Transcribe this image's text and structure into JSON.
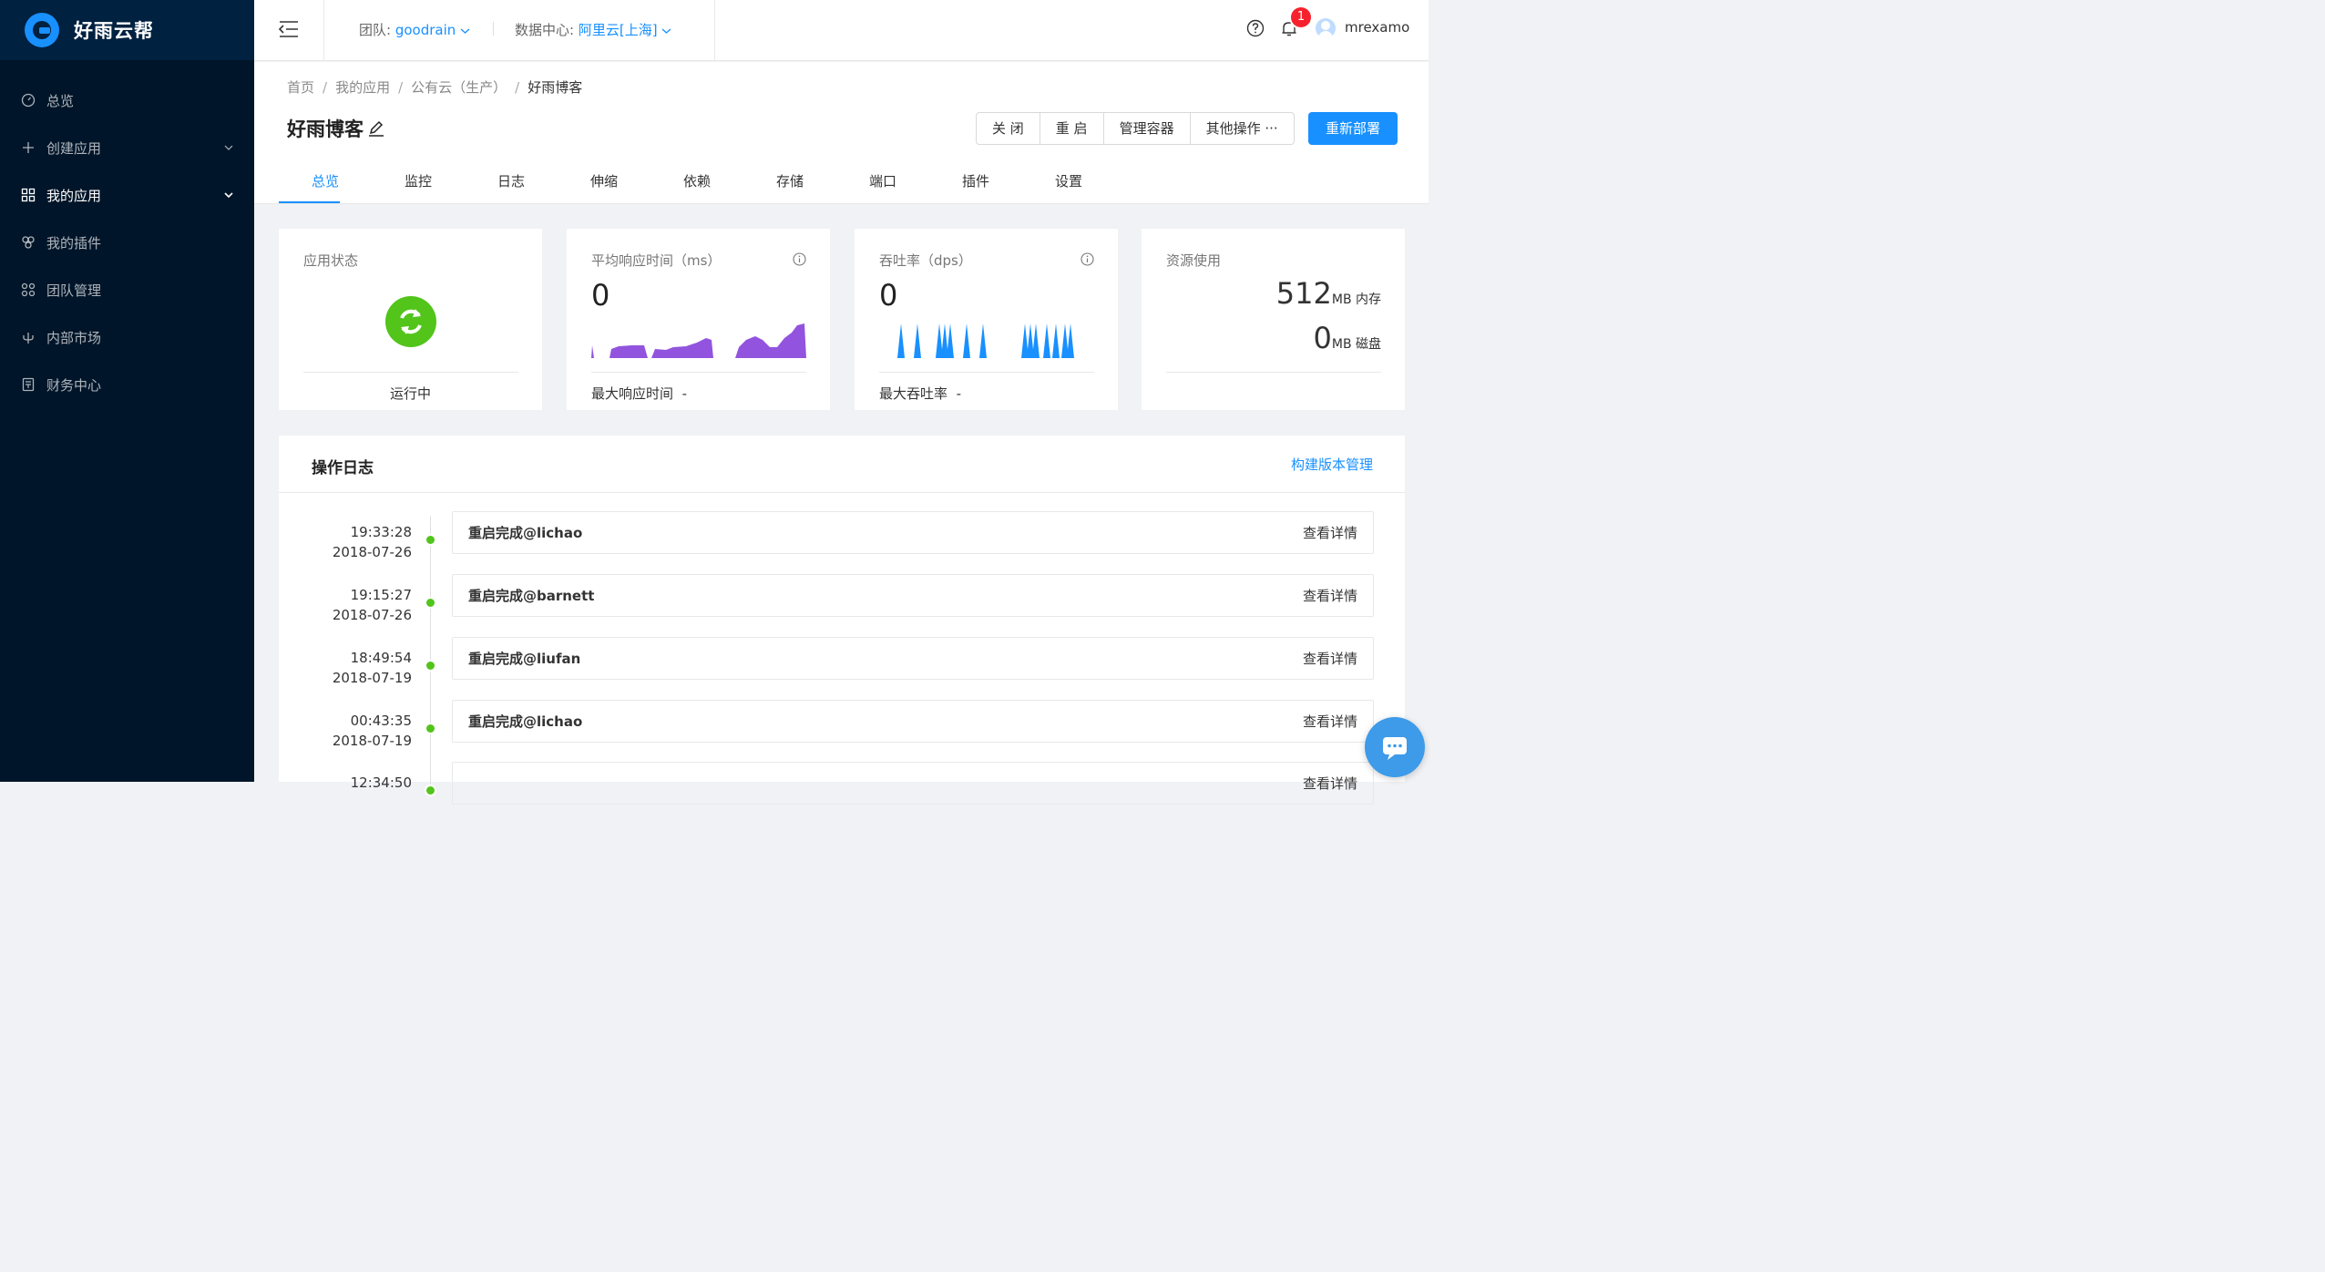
{
  "brand": {
    "name": "好雨云帮",
    "accent": "#1890ff",
    "sidebar_bg": "#001529"
  },
  "sidebar": {
    "items": [
      {
        "label": "总览",
        "icon": "dashboard-icon",
        "active": false,
        "has_arrow": false
      },
      {
        "label": "创建应用",
        "icon": "plus-icon",
        "active": false,
        "has_arrow": true
      },
      {
        "label": "我的应用",
        "icon": "appstore-icon",
        "active": true,
        "has_arrow": true
      },
      {
        "label": "我的插件",
        "icon": "plugin-icon",
        "active": false,
        "has_arrow": false
      },
      {
        "label": "团队管理",
        "icon": "team-icon",
        "active": false,
        "has_arrow": false
      },
      {
        "label": "内部市场",
        "icon": "market-icon",
        "active": false,
        "has_arrow": false
      },
      {
        "label": "财务中心",
        "icon": "finance-icon",
        "active": false,
        "has_arrow": false
      }
    ]
  },
  "header": {
    "team_label": "团队:",
    "team_value": "goodrain",
    "dc_label": "数据中心:",
    "dc_value": "阿里云[上海]",
    "notification_count": "1",
    "username": "mrexamo"
  },
  "breadcrumb": [
    "首页",
    "我的应用",
    "公有云（生产）",
    "好雨博客"
  ],
  "page": {
    "title": "好雨博客",
    "actions": [
      "关 闭",
      "重 启",
      "管理容器",
      "其他操作 ···"
    ],
    "primary_action": "重新部署"
  },
  "tabs": [
    "总览",
    "监控",
    "日志",
    "伸缩",
    "依赖",
    "存储",
    "端口",
    "插件",
    "设置"
  ],
  "cards": {
    "status": {
      "title": "应用状态",
      "value": "运行中",
      "color": "#52c41a"
    },
    "response": {
      "title": "平均响应时间（ms）",
      "value": "0",
      "foot_label": "最大响应时间",
      "foot_value": "-"
    },
    "throughput": {
      "title": "吞吐率（dps）",
      "value": "0",
      "foot_label": "最大吞吐率",
      "foot_value": "-"
    },
    "resources": {
      "title": "资源使用",
      "memory_value": "512",
      "memory_unit": "MB 内存",
      "disk_value": "0",
      "disk_unit": "MB 磁盘"
    }
  },
  "oplog": {
    "title": "操作日志",
    "link": "构建版本管理",
    "detail_label": "查看详情",
    "items": [
      {
        "time": "19:33:28",
        "date": "2018-07-26",
        "message": "重启完成@lichao"
      },
      {
        "time": "19:15:27",
        "date": "2018-07-26",
        "message": "重启完成@barnett"
      },
      {
        "time": "18:49:54",
        "date": "2018-07-19",
        "message": "重启完成@liufan"
      },
      {
        "time": "00:43:35",
        "date": "2018-07-19",
        "message": "重启完成@lichao"
      },
      {
        "time": "12:34:50",
        "date": "",
        "message": ""
      }
    ]
  }
}
